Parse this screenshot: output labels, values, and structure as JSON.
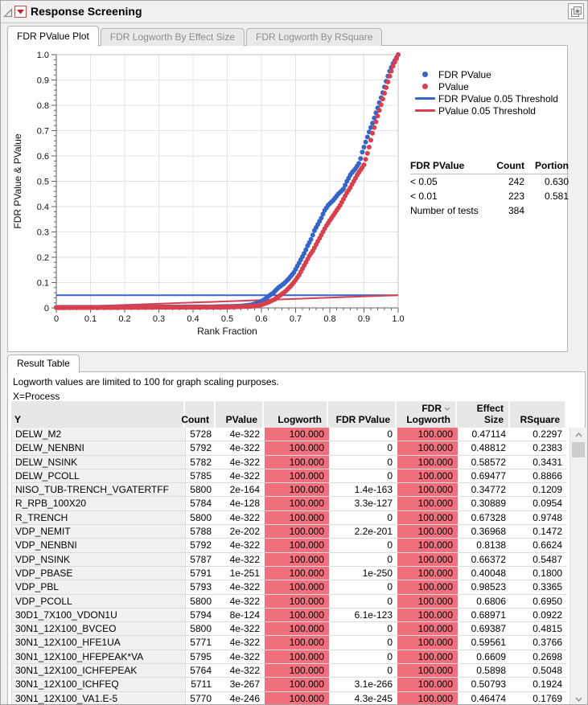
{
  "window": {
    "title": "Response Screening"
  },
  "tabs": [
    {
      "label": "FDR PValue Plot",
      "active": true
    },
    {
      "label": "FDR Logworth By Effect Size",
      "active": false
    },
    {
      "label": "FDR Logworth By RSquare",
      "active": false
    }
  ],
  "plot": {
    "xlabel": "Rank Fraction",
    "ylabel": "FDR PValue & PValue",
    "x_tick_labels": [
      "0",
      "0.1",
      "0.2",
      "0.3",
      "0.4",
      "0.5",
      "0.6",
      "0.7",
      "0.8",
      "0.9",
      "1.0"
    ],
    "y_tick_labels": [
      "0",
      "0.1",
      "0.2",
      "0.3",
      "0.4",
      "0.5",
      "0.6",
      "0.7",
      "0.8",
      "0.9",
      "1.0"
    ],
    "legend": [
      {
        "label": "FDR PValue",
        "type": "dot",
        "color": "#3465c8"
      },
      {
        "label": "PValue",
        "type": "dot",
        "color": "#d8404e"
      },
      {
        "label": "FDR PValue 0.05 Threshold",
        "type": "line",
        "color": "#3465c8"
      },
      {
        "label": "PValue 0.05 Threshold",
        "type": "line",
        "color": "#d8404e"
      }
    ]
  },
  "chart_data": {
    "type": "scatter",
    "xlabel": "Rank Fraction",
    "ylabel": "FDR PValue & PValue",
    "xlim": [
      0,
      1.0
    ],
    "ylim": [
      0,
      1.0
    ],
    "grid": true,
    "legend_position": "top-right",
    "n_points_per_series": 200,
    "series": [
      {
        "name": "FDR PValue",
        "kind": "dots",
        "color": "#3465c8",
        "anchors": [
          [
            0,
            0.002
          ],
          [
            0.45,
            0.004
          ],
          [
            0.54,
            0.007
          ],
          [
            0.57,
            0.012
          ],
          [
            0.59,
            0.02
          ],
          [
            0.605,
            0.03
          ],
          [
            0.62,
            0.045
          ],
          [
            0.635,
            0.06
          ],
          [
            0.65,
            0.08
          ],
          [
            0.665,
            0.095
          ],
          [
            0.68,
            0.115
          ],
          [
            0.695,
            0.14
          ],
          [
            0.705,
            0.165
          ],
          [
            0.715,
            0.19
          ],
          [
            0.725,
            0.215
          ],
          [
            0.735,
            0.245
          ],
          [
            0.745,
            0.27
          ],
          [
            0.755,
            0.305
          ],
          [
            0.765,
            0.33
          ],
          [
            0.775,
            0.355
          ],
          [
            0.785,
            0.385
          ],
          [
            0.795,
            0.405
          ],
          [
            0.81,
            0.425
          ],
          [
            0.825,
            0.45
          ],
          [
            0.84,
            0.47
          ],
          [
            0.85,
            0.5
          ],
          [
            0.862,
            0.53
          ],
          [
            0.875,
            0.55
          ],
          [
            0.887,
            0.575
          ],
          [
            0.895,
            0.615
          ],
          [
            0.905,
            0.655
          ],
          [
            0.915,
            0.695
          ],
          [
            0.925,
            0.73
          ],
          [
            0.935,
            0.77
          ],
          [
            0.945,
            0.81
          ],
          [
            0.955,
            0.85
          ],
          [
            0.965,
            0.895
          ],
          [
            0.975,
            0.935
          ],
          [
            0.985,
            0.965
          ],
          [
            1,
            1
          ]
        ]
      },
      {
        "name": "PValue",
        "kind": "dots",
        "color": "#d8404e",
        "anchors": [
          [
            0,
            0.001
          ],
          [
            0.5,
            0.003
          ],
          [
            0.57,
            0.006
          ],
          [
            0.6,
            0.012
          ],
          [
            0.62,
            0.022
          ],
          [
            0.64,
            0.035
          ],
          [
            0.655,
            0.05
          ],
          [
            0.67,
            0.065
          ],
          [
            0.685,
            0.085
          ],
          [
            0.7,
            0.11
          ],
          [
            0.71,
            0.13
          ],
          [
            0.72,
            0.155
          ],
          [
            0.73,
            0.18
          ],
          [
            0.74,
            0.205
          ],
          [
            0.75,
            0.225
          ],
          [
            0.76,
            0.25
          ],
          [
            0.77,
            0.275
          ],
          [
            0.78,
            0.3
          ],
          [
            0.79,
            0.325
          ],
          [
            0.8,
            0.345
          ],
          [
            0.81,
            0.365
          ],
          [
            0.82,
            0.385
          ],
          [
            0.83,
            0.405
          ],
          [
            0.84,
            0.43
          ],
          [
            0.85,
            0.455
          ],
          [
            0.86,
            0.475
          ],
          [
            0.87,
            0.5
          ],
          [
            0.88,
            0.525
          ],
          [
            0.89,
            0.545
          ],
          [
            0.9,
            0.565
          ],
          [
            0.908,
            0.6
          ],
          [
            0.916,
            0.64
          ],
          [
            0.925,
            0.69
          ],
          [
            0.935,
            0.735
          ],
          [
            0.945,
            0.78
          ],
          [
            0.955,
            0.825
          ],
          [
            0.965,
            0.87
          ],
          [
            0.975,
            0.915
          ],
          [
            0.985,
            0.955
          ],
          [
            1,
            1
          ]
        ]
      },
      {
        "name": "FDR PValue 0.05 Threshold",
        "kind": "line",
        "color": "#3465c8",
        "points": [
          [
            0,
            0.05
          ],
          [
            1,
            0.05
          ]
        ]
      },
      {
        "name": "PValue 0.05 Threshold",
        "kind": "line",
        "color": "#d8404e",
        "points": [
          [
            0,
            0.002
          ],
          [
            1,
            0.05
          ]
        ]
      }
    ]
  },
  "summary_table": {
    "headers": [
      "FDR PValue",
      "Count",
      "Portion"
    ],
    "rows": [
      [
        "< 0.05",
        "242",
        "0.630"
      ],
      [
        "< 0.01",
        "223",
        "0.581"
      ],
      [
        "Number of tests",
        "384",
        ""
      ]
    ]
  },
  "result_section": {
    "tab": "Result Table",
    "note": "Logworth values are limited to 100 for graph scaling purposes.",
    "x_label": "X=Process",
    "table": {
      "columns": [
        {
          "label": "Y",
          "align": "left"
        },
        {
          "label": "Count",
          "align": "right"
        },
        {
          "label": "PValue",
          "align": "right"
        },
        {
          "label": "Logworth",
          "align": "right",
          "highlight": true
        },
        {
          "label": "FDR PValue",
          "align": "right"
        },
        {
          "label": "FDR Logworth",
          "lines": [
            "FDR",
            "Logworth"
          ],
          "align": "right",
          "highlight": true,
          "sort": "desc"
        },
        {
          "label": "Effect Size",
          "align": "right"
        },
        {
          "label": "RSquare",
          "align": "right"
        }
      ],
      "rows": [
        [
          "DELW_M2",
          "5728",
          "4e-322",
          "100.000",
          "0",
          "100.000",
          "0.47114",
          "0.2297"
        ],
        [
          "DELW_NENBNI",
          "5792",
          "4e-322",
          "100.000",
          "0",
          "100.000",
          "0.48812",
          "0.2383"
        ],
        [
          "DELW_NSINK",
          "5782",
          "4e-322",
          "100.000",
          "0",
          "100.000",
          "0.58572",
          "0.3431"
        ],
        [
          "DELW_PCOLL",
          "5785",
          "4e-322",
          "100.000",
          "0",
          "100.000",
          "0.69477",
          "0.8866"
        ],
        [
          "NISO_TUB-TRENCH_VGATERTFF",
          "5800",
          "2e-164",
          "100.000",
          "1.4e-163",
          "100.000",
          "0.34772",
          "0.1209"
        ],
        [
          "R_RPB_100X20",
          "5784",
          "4e-128",
          "100.000",
          "3.3e-127",
          "100.000",
          "0.30889",
          "0.0954"
        ],
        [
          "R_TRENCH",
          "5800",
          "4e-322",
          "100.000",
          "0",
          "100.000",
          "0.67328",
          "0.9748"
        ],
        [
          "VDP_NEMIT",
          "5788",
          "2e-202",
          "100.000",
          "2.2e-201",
          "100.000",
          "0.36968",
          "0.1472"
        ],
        [
          "VDP_NENBNI",
          "5792",
          "4e-322",
          "100.000",
          "0",
          "100.000",
          "0.8138",
          "0.6624"
        ],
        [
          "VDP_NSINK",
          "5787",
          "4e-322",
          "100.000",
          "0",
          "100.000",
          "0.66372",
          "0.5487"
        ],
        [
          "VDP_PBASE",
          "5791",
          "1e-251",
          "100.000",
          "1e-250",
          "100.000",
          "0.40048",
          "0.1800"
        ],
        [
          "VDP_PBL",
          "5793",
          "4e-322",
          "100.000",
          "0",
          "100.000",
          "0.98523",
          "0.3365"
        ],
        [
          "VDP_PCOLL",
          "5800",
          "4e-322",
          "100.000",
          "0",
          "100.000",
          "0.6806",
          "0.6950"
        ],
        [
          "30D1_7X100_VDON1U",
          "5794",
          "8e-124",
          "100.000",
          "6.1e-123",
          "100.000",
          "0.68971",
          "0.0922"
        ],
        [
          "30N1_12X100_BVCEO",
          "5800",
          "4e-322",
          "100.000",
          "0",
          "100.000",
          "0.69387",
          "0.4815"
        ],
        [
          "30N1_12X100_HFE1UA",
          "5771",
          "4e-322",
          "100.000",
          "0",
          "100.000",
          "0.59561",
          "0.3766"
        ],
        [
          "30N1_12X100_HFEPEAK*VA",
          "5795",
          "4e-322",
          "100.000",
          "0",
          "100.000",
          "0.6609",
          "0.2698"
        ],
        [
          "30N1_12X100_ICHFEPEAK",
          "5764",
          "4e-322",
          "100.000",
          "0",
          "100.000",
          "0.5898",
          "0.5048"
        ],
        [
          "30N1_12X100_ICHFEQ",
          "5711",
          "3e-267",
          "100.000",
          "3.1e-266",
          "100.000",
          "0.50793",
          "0.1924"
        ],
        [
          "30N1_12X100_VA1.E-5",
          "5770",
          "4e-246",
          "100.000",
          "4.3e-245",
          "100.000",
          "0.46474",
          "0.1769"
        ]
      ]
    }
  },
  "colors": {
    "blue": "#3465c8",
    "red": "#d8404e",
    "red_cell": "#f0717d",
    "header_bg": "#e7e7e7",
    "grid": "#e3e3e3",
    "axis": "#616161",
    "frame": "#c2c2c2"
  }
}
